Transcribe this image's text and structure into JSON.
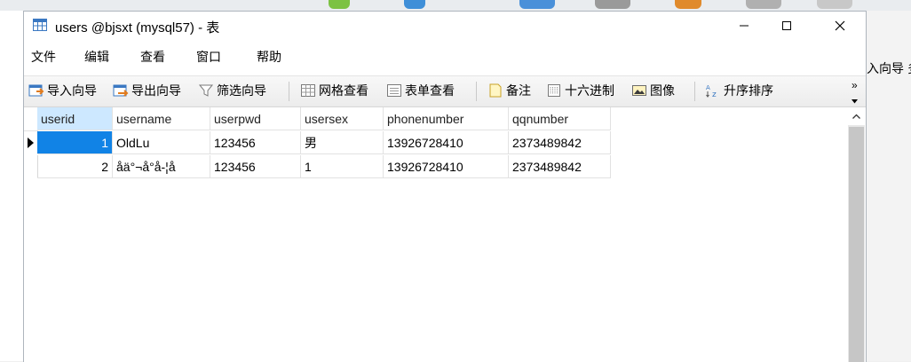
{
  "window": {
    "title": "users @bjsxt (mysql57) - 表",
    "controls": {
      "minimize": "minimize",
      "maximize": "maximize",
      "close": "close"
    }
  },
  "menu": [
    {
      "label": "文件"
    },
    {
      "label": "编辑"
    },
    {
      "label": "查看"
    },
    {
      "label": "窗口"
    },
    {
      "label": "帮助"
    }
  ],
  "toolbar": {
    "import_wizard": "导入向导",
    "export_wizard": "导出向导",
    "filter_wizard": "筛选向导",
    "grid_view": "网格查看",
    "form_view": "表单查看",
    "memo": "备注",
    "hex": "十六进制",
    "image": "图像",
    "sort_asc": "升序排序",
    "more": "»"
  },
  "background": {
    "right_label": "入向导",
    "right_label2": "多"
  },
  "table": {
    "columns": [
      "userid",
      "username",
      "userpwd",
      "usersex",
      "phonenumber",
      "qqnumber"
    ],
    "rows": [
      [
        "1",
        "OldLu",
        "123456",
        "男",
        "13926728410",
        "2373489842"
      ],
      [
        "2",
        "åä°¬å°å-¦å",
        "123456",
        "1",
        "13926728410",
        "2373489842"
      ]
    ]
  }
}
